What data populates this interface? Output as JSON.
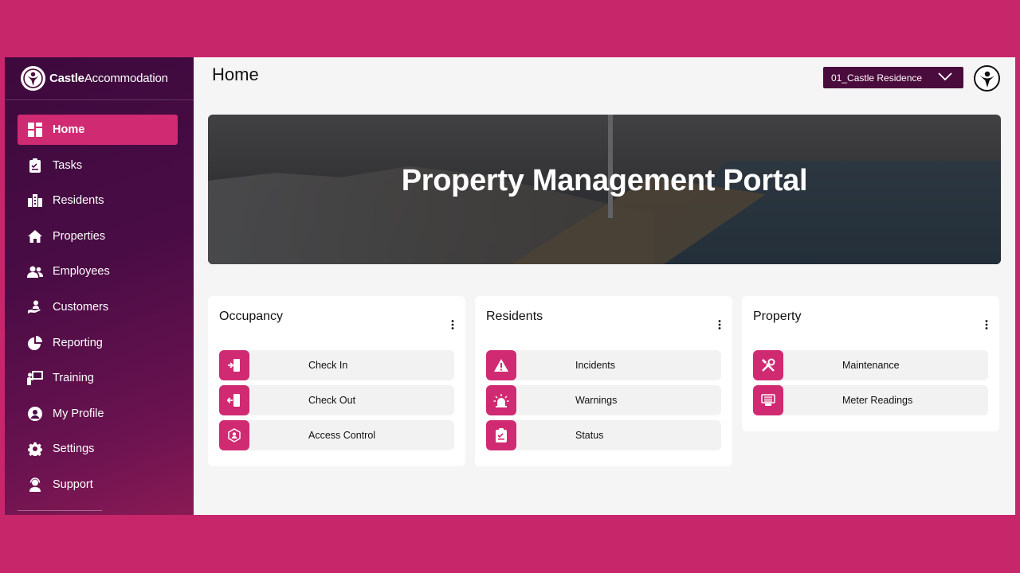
{
  "brand": {
    "bold": "Castle",
    "rest": "Accommodation"
  },
  "sidebar": {
    "items": [
      {
        "label": "Home",
        "icon": "grid-icon",
        "active": true
      },
      {
        "label": "Tasks",
        "icon": "clipboard-icon"
      },
      {
        "label": "Residents",
        "icon": "building-icon"
      },
      {
        "label": "Properties",
        "icon": "house-icon"
      },
      {
        "label": "Employees",
        "icon": "users-icon"
      },
      {
        "label": "Customers",
        "icon": "hand-user-icon"
      },
      {
        "label": "Reporting",
        "icon": "pie-chart-icon"
      },
      {
        "label": "Training",
        "icon": "presentation-icon"
      },
      {
        "label": "My Profile",
        "icon": "user-circle-icon"
      },
      {
        "label": "Settings",
        "icon": "gear-icon"
      },
      {
        "label": "Support",
        "icon": "headset-icon"
      }
    ]
  },
  "header": {
    "title": "Home",
    "property_select": "01_Castle Residence"
  },
  "banner": {
    "title": "Property Management Portal"
  },
  "cards": [
    {
      "title": "Occupancy",
      "actions": [
        {
          "label": "Check In",
          "icon": "sign-in-icon"
        },
        {
          "label": "Check Out",
          "icon": "sign-out-icon"
        },
        {
          "label": "Access Control",
          "icon": "access-control-icon"
        }
      ]
    },
    {
      "title": "Residents",
      "actions": [
        {
          "label": "Incidents",
          "icon": "warning-triangle-icon"
        },
        {
          "label": "Warnings",
          "icon": "siren-icon"
        },
        {
          "label": "Status",
          "icon": "clipboard-check-icon"
        }
      ]
    },
    {
      "title": "Property",
      "actions": [
        {
          "label": "Maintenance",
          "icon": "tools-icon"
        },
        {
          "label": "Meter Readings",
          "icon": "meter-icon"
        }
      ]
    }
  ],
  "colors": {
    "page_bg": "#c8266a",
    "accent": "#d02a72",
    "sidebar_dark": "#3d0a3d",
    "select_bg": "#4a0c3c"
  }
}
